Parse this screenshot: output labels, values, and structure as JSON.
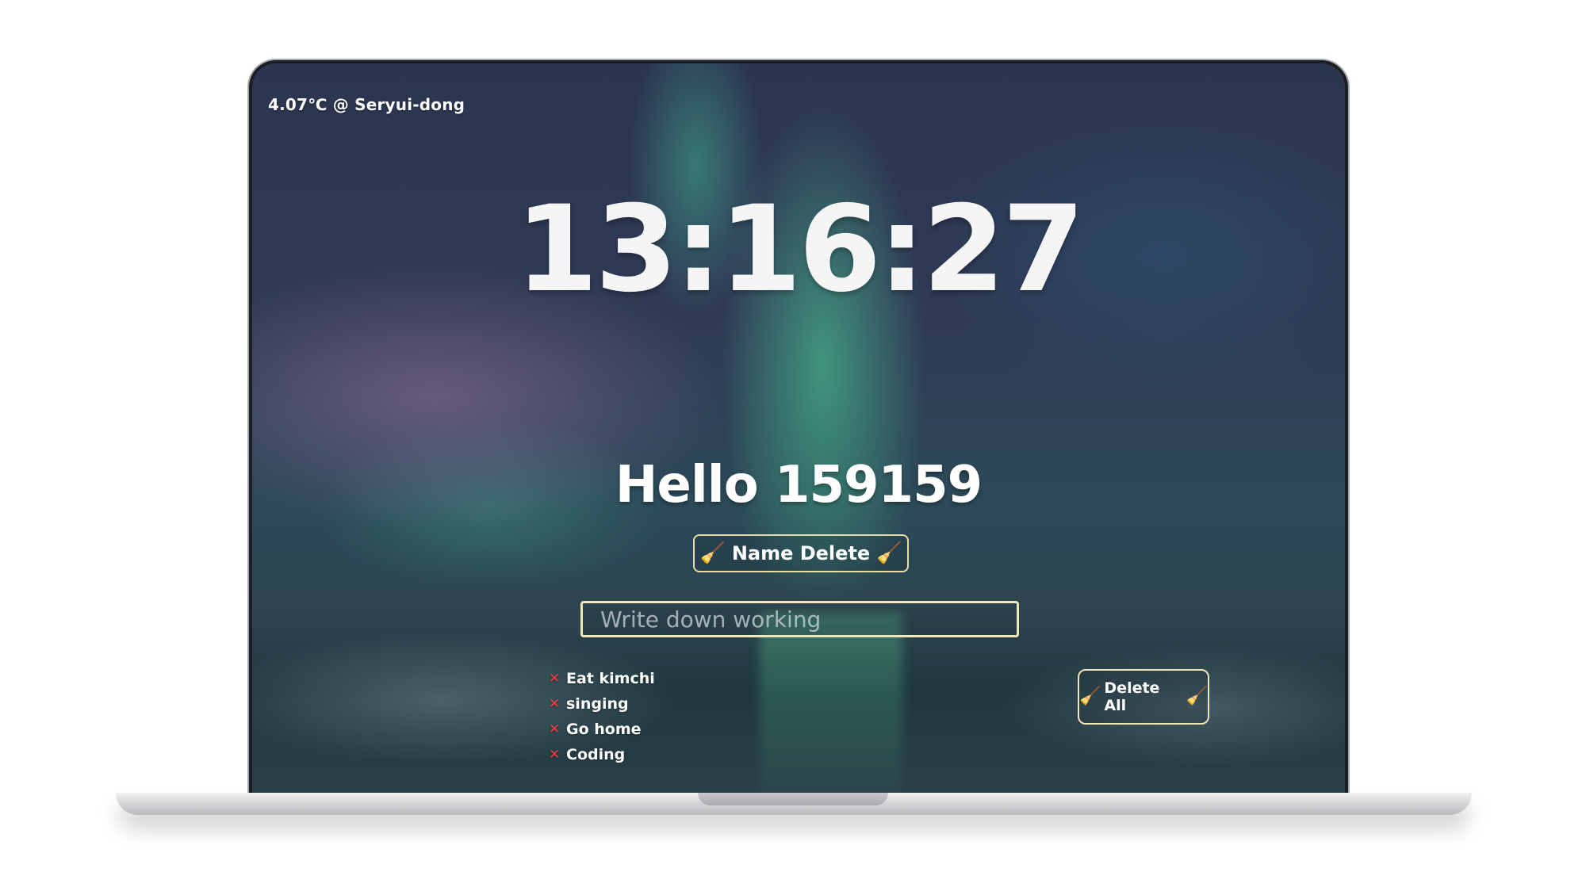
{
  "weather": {
    "text": "4.07℃ @ Seryui-dong"
  },
  "clock": {
    "time": "13:16:27"
  },
  "greeting": {
    "text": "Hello 159159"
  },
  "name_delete": {
    "label": "Name Delete",
    "icon": "broom-icon"
  },
  "todo_input": {
    "placeholder": "Write down working",
    "value": ""
  },
  "todos": [
    {
      "text": "Eat kimchi"
    },
    {
      "text": "singing"
    },
    {
      "text": "Go home"
    },
    {
      "text": "Coding"
    }
  ],
  "delete_all": {
    "label": "Delete All",
    "icon": "broom-icon"
  },
  "colors": {
    "accent_border": "#f0e6b8",
    "delete_x": "#ff3b3b",
    "broom": "#f2b640"
  }
}
